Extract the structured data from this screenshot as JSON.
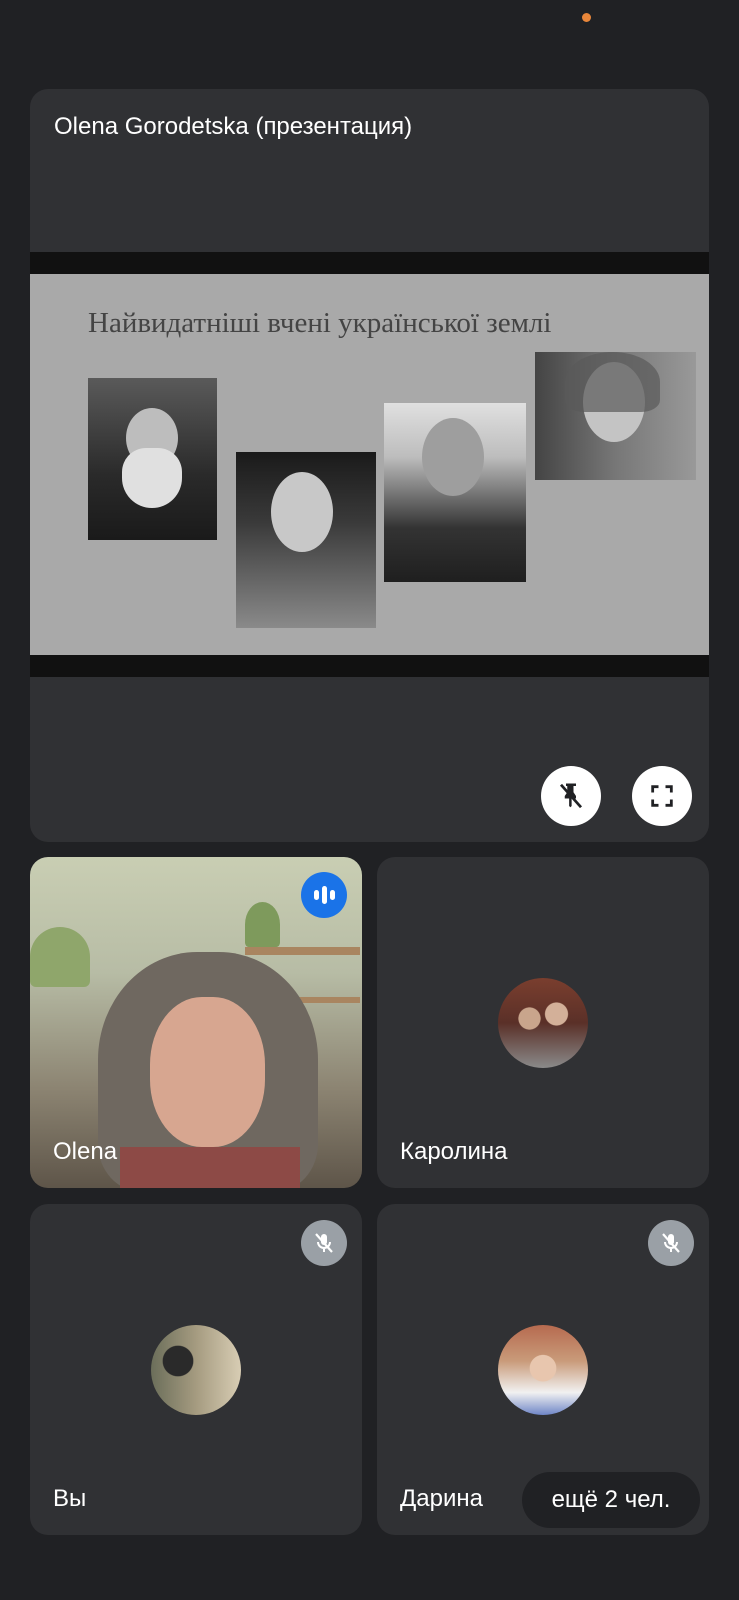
{
  "status": {
    "indicator_color": "#e8863a"
  },
  "presentation": {
    "title": "Olena Gorodetska (презентация)",
    "slide_title": "Найвидатніші вчені української землі",
    "photos": [
      "portrait-1",
      "portrait-2",
      "portrait-3",
      "portrait-4"
    ],
    "actions": {
      "unpin_icon": "unpin-icon",
      "fullscreen_icon": "fullscreen-icon"
    }
  },
  "participants": [
    {
      "name": "Olena",
      "state": "speaking",
      "video": true
    },
    {
      "name": "Каролина",
      "state": "unmuted",
      "video": false
    },
    {
      "name": "Вы",
      "state": "muted",
      "video": false
    },
    {
      "name": "Дарина",
      "state": "muted",
      "video": false
    }
  ],
  "more": {
    "label": "ещё 2 чел."
  },
  "colors": {
    "background": "#202124",
    "tile": "#303134",
    "accent_blue": "#1a73e8",
    "muted_badge": "#9aa0a6"
  }
}
